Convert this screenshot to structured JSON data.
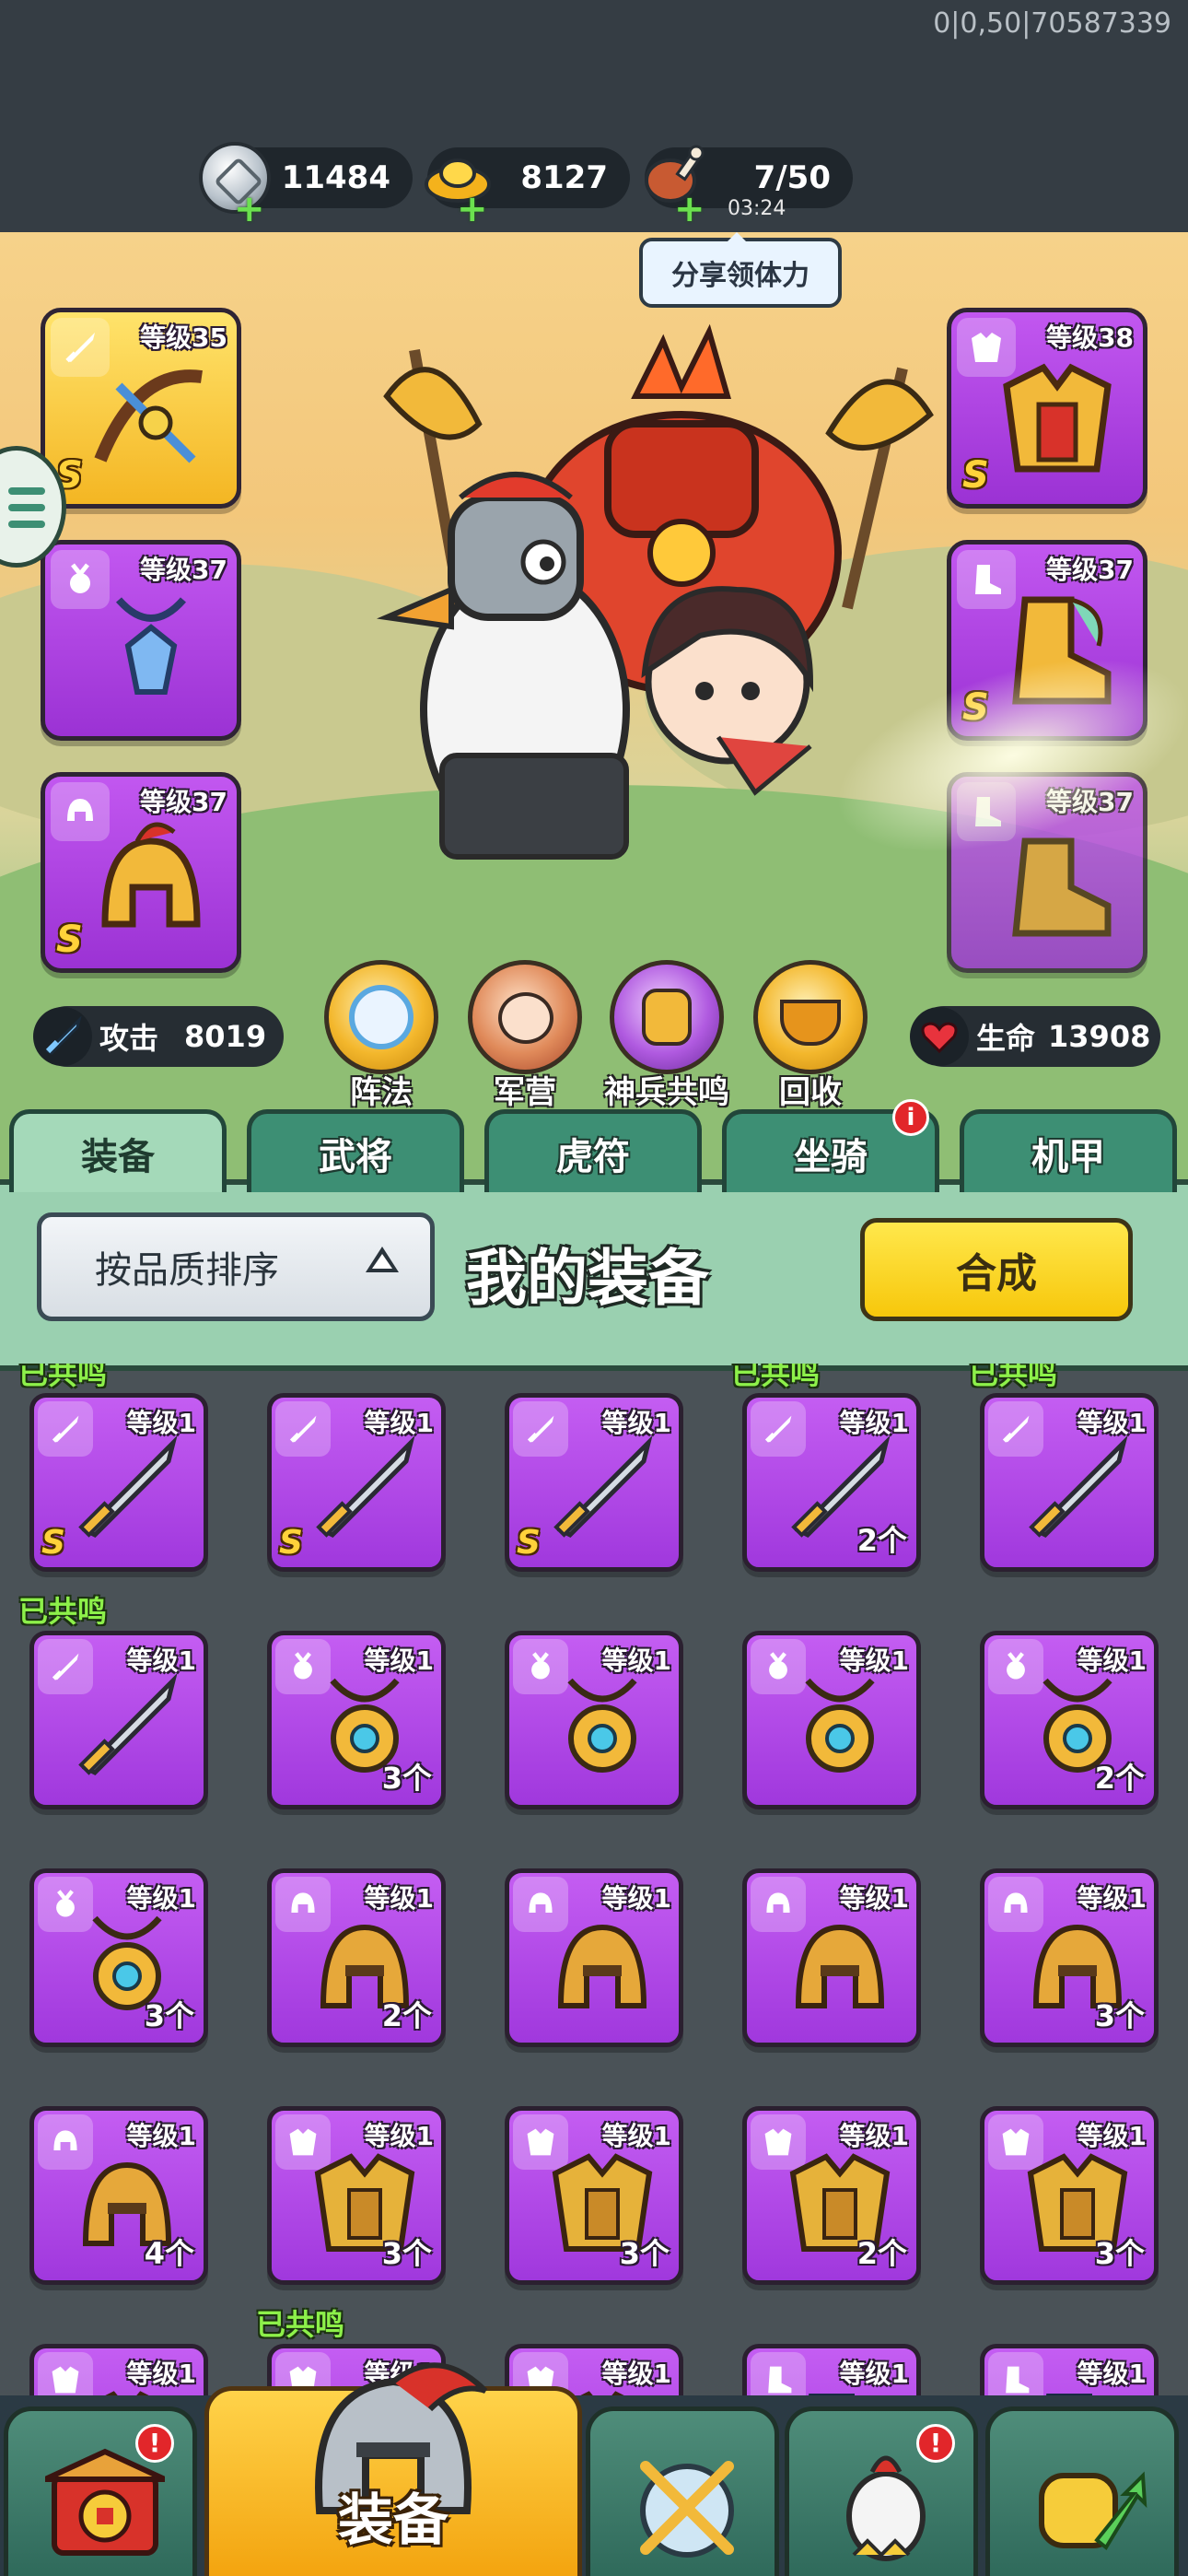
{
  "debug_id": "0|0,50|70587339",
  "resources": {
    "silver": {
      "value": "11484",
      "icon": "silver-coin-icon"
    },
    "gold": {
      "value": "8127",
      "icon": "gold-ingot-icon"
    },
    "stamina": {
      "value": "7/50",
      "timer": "03:24",
      "icon": "meat-drumstick-icon"
    }
  },
  "share_button": "分享领体力",
  "equipped": {
    "left": [
      {
        "level": "等级35",
        "rarity": "S",
        "type": "weapon"
      },
      {
        "level": "等级37",
        "type": "amulet"
      },
      {
        "level": "等级37",
        "rarity": "S",
        "type": "helmet"
      }
    ],
    "right": [
      {
        "level": "等级38",
        "rarity": "S",
        "type": "armor"
      },
      {
        "level": "等级37",
        "rarity": "S",
        "type": "boots"
      },
      {
        "level": "等级37",
        "type": "boots"
      }
    ]
  },
  "stats": {
    "attack_label": "攻击",
    "attack_value": "8019",
    "hp_label": "生命",
    "hp_value": "13908"
  },
  "functions": [
    "阵法",
    "军营",
    "神兵共鸣",
    "回收"
  ],
  "tabs": [
    "装备",
    "武将",
    "虎符",
    "坐骑",
    "机甲"
  ],
  "tab_badge": "i",
  "sort_select": "按品质排序",
  "section_title": "我的装备",
  "compose_button": "合成",
  "resonance_label": "已共鸣",
  "inventory": [
    {
      "level": "等级1",
      "count": "",
      "rarity": "S",
      "resonated": true
    },
    {
      "level": "等级1",
      "count": "",
      "rarity": "S",
      "resonated": false
    },
    {
      "level": "等级1",
      "count": "",
      "rarity": "S",
      "resonated": false
    },
    {
      "level": "等级1",
      "count": "2个",
      "rarity": "",
      "resonated": true
    },
    {
      "level": "等级1",
      "count": "",
      "rarity": "",
      "resonated": true
    },
    {
      "level": "等级1",
      "count": "",
      "rarity": "",
      "resonated": true
    },
    {
      "level": "等级1",
      "count": "3个",
      "rarity": "",
      "resonated": false
    },
    {
      "level": "等级1",
      "count": "",
      "rarity": "",
      "resonated": false
    },
    {
      "level": "等级1",
      "count": "",
      "rarity": "",
      "resonated": false
    },
    {
      "level": "等级1",
      "count": "2个",
      "rarity": "",
      "resonated": false
    },
    {
      "level": "等级1",
      "count": "3个",
      "rarity": "",
      "resonated": false
    },
    {
      "level": "等级1",
      "count": "2个",
      "rarity": "",
      "resonated": false
    },
    {
      "level": "等级1",
      "count": "",
      "rarity": "",
      "resonated": false
    },
    {
      "level": "等级1",
      "count": "",
      "rarity": "",
      "resonated": false
    },
    {
      "level": "等级1",
      "count": "3个",
      "rarity": "",
      "resonated": false
    },
    {
      "level": "等级1",
      "count": "4个",
      "rarity": "",
      "resonated": false
    },
    {
      "level": "等级1",
      "count": "3个",
      "rarity": "",
      "resonated": false
    },
    {
      "level": "等级1",
      "count": "3个",
      "rarity": "",
      "resonated": false
    },
    {
      "level": "等级1",
      "count": "2个",
      "rarity": "",
      "resonated": false
    },
    {
      "level": "等级1",
      "count": "3个",
      "rarity": "",
      "resonated": false
    },
    {
      "level": "等级1",
      "count": "",
      "rarity": "",
      "resonated": false
    },
    {
      "level": "等级1",
      "count": "",
      "rarity": "",
      "resonated": true
    },
    {
      "level": "等级1",
      "count": "",
      "rarity": "",
      "resonated": false
    },
    {
      "level": "等级1",
      "count": "",
      "rarity": "",
      "resonated": false
    },
    {
      "level": "等级1",
      "count": "",
      "rarity": "",
      "resonated": false
    }
  ],
  "bottom_nav": {
    "active_label": "装备",
    "badge": "!"
  },
  "colors": {
    "epic_purple": "#a038dd",
    "legendary_gold": "#f4b623",
    "active_tab": "#a4d9b9",
    "compose_yellow": "#f7c70b",
    "resonance_green": "#8df04a"
  }
}
